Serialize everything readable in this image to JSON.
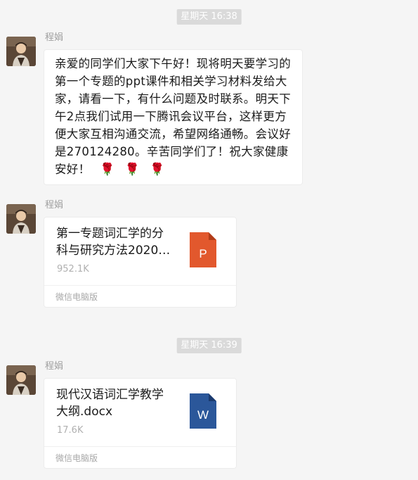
{
  "timestamps": [
    "星期天 16:38",
    "星期天 16:39"
  ],
  "messages": [
    {
      "sender": "程娟",
      "text": "亲爱的同学们大家下午好！现将明天要学习的第一个专题的ppt课件和相关学习材料发给大家，请看一下，有什么问题及时联系。明天下午2点我们试用一下腾讯会议平台，这样更方便大家互相沟通交流，希望网络通畅。会议好是270124280。辛苦同学们了！祝大家健康安好！",
      "emoji": [
        "🌹",
        "🌹",
        "🌹"
      ]
    },
    {
      "sender": "程娟",
      "file_name": "第一专题词汇学的分科与研究方法2020…",
      "file_size": "952.1K",
      "source": "微信电脑版",
      "icon": "ppt-file-icon",
      "icon_letter": "P",
      "icon_color": "#e2582d"
    },
    {
      "sender": "程娟",
      "file_name": "现代汉语词汇学教学大纲.docx",
      "file_size": "17.6K",
      "source": "微信电脑版",
      "icon": "word-file-icon",
      "icon_letter": "W",
      "icon_color": "#2b579a"
    }
  ]
}
